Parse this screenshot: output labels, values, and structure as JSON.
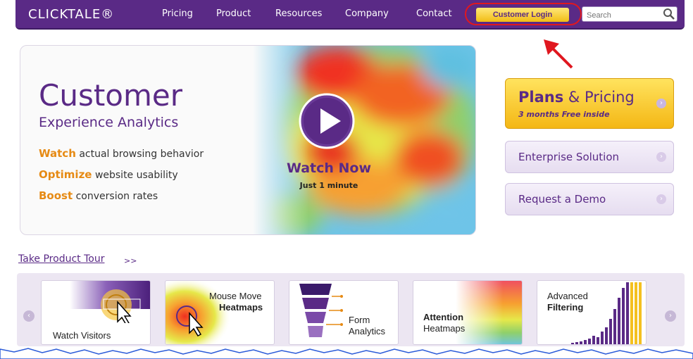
{
  "header": {
    "logo": "CLICKTALE®",
    "nav": [
      "Pricing",
      "Product",
      "Resources",
      "Company",
      "Contact"
    ],
    "login_label": "Customer Login",
    "search_placeholder": "Search"
  },
  "hero": {
    "title": "Customer",
    "subtitle": "Experience Analytics",
    "bullets": [
      {
        "keyword": "Watch",
        "text": "actual browsing behavior"
      },
      {
        "keyword": "Optimize",
        "text": "website usability"
      },
      {
        "keyword": "Boost",
        "text": "conversion rates"
      }
    ],
    "cta": "Watch Now",
    "cta_sub": "Just 1 minute"
  },
  "side_buttons": {
    "plans_main": "Plans",
    "plans_amp": "& Pricing",
    "plans_sub": "3 months Free inside",
    "enterprise": "Enterprise Solution",
    "demo": "Request a Demo"
  },
  "tour": {
    "link": "Take Product Tour",
    "arrows": ">>",
    "cards": [
      {
        "line1": "Watch Visitors",
        "line2": ""
      },
      {
        "line1": "Mouse Move",
        "line2": "Heatmaps"
      },
      {
        "line1": "Form",
        "line2": "Analytics"
      },
      {
        "line1": "Attention",
        "line2": "Heatmaps"
      },
      {
        "line1": "Advanced",
        "line2": "Filtering"
      }
    ]
  },
  "colors": {
    "brand_purple": "#5a2a86",
    "accent_orange": "#e68a14",
    "login_yellow": "#f1bd14",
    "annotation_red": "#e0171f"
  }
}
